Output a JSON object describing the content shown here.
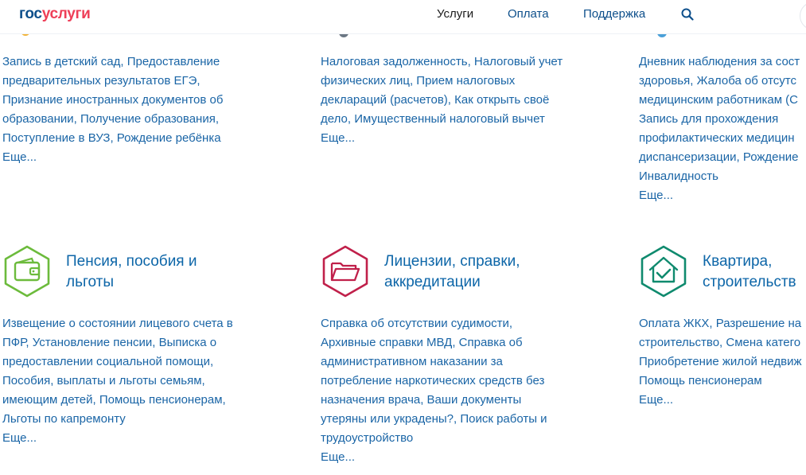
{
  "header": {
    "logo": {
      "part1": "гос",
      "part2": "услуги"
    },
    "nav": [
      "Услуги",
      "Оплата",
      "Поддержка"
    ],
    "search_icon": "search-icon"
  },
  "colors": {
    "brand_blue": "#0d4f8b",
    "brand_red": "#ee3f58",
    "link": "#1a65a6",
    "pension_green": "#6cbb3c",
    "licenses_red": "#c0204a",
    "housing_teal": "#0f8a6e"
  },
  "top_row": {
    "col1": {
      "lines": [
        "Запись в детский сад, Предоставление",
        "предварительных результатов ЕГЭ,",
        "Признание иностранных документов об",
        "образовании, Получение образования,",
        "Поступление в ВУЗ, Рождение ребёнка"
      ],
      "more": "Еще..."
    },
    "col2": {
      "lines": [
        "Налоговая задолженность, Налоговый учет",
        "физических лиц, Прием налоговых",
        "деклараций (расчетов), Как открыть своё",
        "дело, Имущественный налоговый вычет"
      ],
      "more": "Еще..."
    },
    "col3": {
      "lines": [
        "Дневник наблюдения за сост",
        "здоровья, Жалоба об отсутс",
        "медицинским работникам (С",
        "Запись для прохождения",
        "профилактических медицин",
        "диспансеризации, Рождение",
        "Инвалидность"
      ],
      "more": "Еще..."
    }
  },
  "categories": [
    {
      "icon": "wallet-icon",
      "title_line1": "Пенсия, пособия и",
      "title_line2": "льготы",
      "lines": [
        "Извещение о состоянии лицевого счета в",
        "ПФР, Установление пенсии, Выписка о",
        "предоставлении социальной помощи,",
        "Пособия, выплаты и льготы семьям,",
        "имеющим детей, Помощь пенсионерам,",
        "Льготы по капремонту"
      ],
      "more": "Еще..."
    },
    {
      "icon": "folder-icon",
      "title_line1": "Лицензии, справки,",
      "title_line2": "аккредитации",
      "lines": [
        "Справка об отсутствии судимости,",
        "Архивные справки МВД, Справка об",
        "административном наказании за",
        "потребление наркотических средств без",
        "назначения врача, Ваши документы",
        "утеряны или украдены?, Поиск работы и",
        "трудоустройство"
      ],
      "more": "Еще..."
    },
    {
      "icon": "house-check-icon",
      "title_line1": "Квартира,",
      "title_line2": "строительств",
      "lines": [
        "Оплата ЖКХ, Разрешение на",
        "строительство, Смена катего",
        "Приобретение жилой недвиж",
        "Помощь пенсионерам"
      ],
      "more": "Еще..."
    }
  ]
}
